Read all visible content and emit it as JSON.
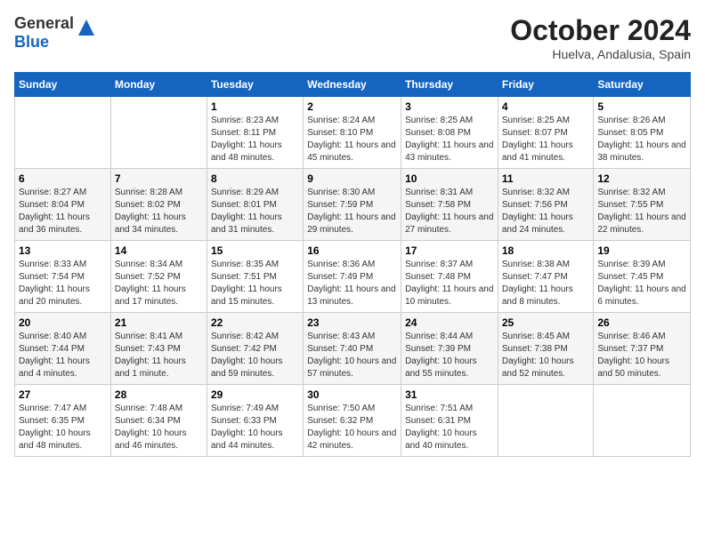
{
  "header": {
    "logo_line1": "General",
    "logo_line2": "Blue",
    "month": "October 2024",
    "location": "Huelva, Andalusia, Spain"
  },
  "weekdays": [
    "Sunday",
    "Monday",
    "Tuesday",
    "Wednesday",
    "Thursday",
    "Friday",
    "Saturday"
  ],
  "weeks": [
    [
      null,
      null,
      {
        "day": 1,
        "sunrise": "8:23 AM",
        "sunset": "8:11 PM",
        "daylight": "11 hours and 48 minutes."
      },
      {
        "day": 2,
        "sunrise": "8:24 AM",
        "sunset": "8:10 PM",
        "daylight": "11 hours and 45 minutes."
      },
      {
        "day": 3,
        "sunrise": "8:25 AM",
        "sunset": "8:08 PM",
        "daylight": "11 hours and 43 minutes."
      },
      {
        "day": 4,
        "sunrise": "8:25 AM",
        "sunset": "8:07 PM",
        "daylight": "11 hours and 41 minutes."
      },
      {
        "day": 5,
        "sunrise": "8:26 AM",
        "sunset": "8:05 PM",
        "daylight": "11 hours and 38 minutes."
      }
    ],
    [
      {
        "day": 6,
        "sunrise": "8:27 AM",
        "sunset": "8:04 PM",
        "daylight": "11 hours and 36 minutes."
      },
      {
        "day": 7,
        "sunrise": "8:28 AM",
        "sunset": "8:02 PM",
        "daylight": "11 hours and 34 minutes."
      },
      {
        "day": 8,
        "sunrise": "8:29 AM",
        "sunset": "8:01 PM",
        "daylight": "11 hours and 31 minutes."
      },
      {
        "day": 9,
        "sunrise": "8:30 AM",
        "sunset": "7:59 PM",
        "daylight": "11 hours and 29 minutes."
      },
      {
        "day": 10,
        "sunrise": "8:31 AM",
        "sunset": "7:58 PM",
        "daylight": "11 hours and 27 minutes."
      },
      {
        "day": 11,
        "sunrise": "8:32 AM",
        "sunset": "7:56 PM",
        "daylight": "11 hours and 24 minutes."
      },
      {
        "day": 12,
        "sunrise": "8:32 AM",
        "sunset": "7:55 PM",
        "daylight": "11 hours and 22 minutes."
      }
    ],
    [
      {
        "day": 13,
        "sunrise": "8:33 AM",
        "sunset": "7:54 PM",
        "daylight": "11 hours and 20 minutes."
      },
      {
        "day": 14,
        "sunrise": "8:34 AM",
        "sunset": "7:52 PM",
        "daylight": "11 hours and 17 minutes."
      },
      {
        "day": 15,
        "sunrise": "8:35 AM",
        "sunset": "7:51 PM",
        "daylight": "11 hours and 15 minutes."
      },
      {
        "day": 16,
        "sunrise": "8:36 AM",
        "sunset": "7:49 PM",
        "daylight": "11 hours and 13 minutes."
      },
      {
        "day": 17,
        "sunrise": "8:37 AM",
        "sunset": "7:48 PM",
        "daylight": "11 hours and 10 minutes."
      },
      {
        "day": 18,
        "sunrise": "8:38 AM",
        "sunset": "7:47 PM",
        "daylight": "11 hours and 8 minutes."
      },
      {
        "day": 19,
        "sunrise": "8:39 AM",
        "sunset": "7:45 PM",
        "daylight": "11 hours and 6 minutes."
      }
    ],
    [
      {
        "day": 20,
        "sunrise": "8:40 AM",
        "sunset": "7:44 PM",
        "daylight": "11 hours and 4 minutes."
      },
      {
        "day": 21,
        "sunrise": "8:41 AM",
        "sunset": "7:43 PM",
        "daylight": "11 hours and 1 minute."
      },
      {
        "day": 22,
        "sunrise": "8:42 AM",
        "sunset": "7:42 PM",
        "daylight": "10 hours and 59 minutes."
      },
      {
        "day": 23,
        "sunrise": "8:43 AM",
        "sunset": "7:40 PM",
        "daylight": "10 hours and 57 minutes."
      },
      {
        "day": 24,
        "sunrise": "8:44 AM",
        "sunset": "7:39 PM",
        "daylight": "10 hours and 55 minutes."
      },
      {
        "day": 25,
        "sunrise": "8:45 AM",
        "sunset": "7:38 PM",
        "daylight": "10 hours and 52 minutes."
      },
      {
        "day": 26,
        "sunrise": "8:46 AM",
        "sunset": "7:37 PM",
        "daylight": "10 hours and 50 minutes."
      }
    ],
    [
      {
        "day": 27,
        "sunrise": "7:47 AM",
        "sunset": "6:35 PM",
        "daylight": "10 hours and 48 minutes."
      },
      {
        "day": 28,
        "sunrise": "7:48 AM",
        "sunset": "6:34 PM",
        "daylight": "10 hours and 46 minutes."
      },
      {
        "day": 29,
        "sunrise": "7:49 AM",
        "sunset": "6:33 PM",
        "daylight": "10 hours and 44 minutes."
      },
      {
        "day": 30,
        "sunrise": "7:50 AM",
        "sunset": "6:32 PM",
        "daylight": "10 hours and 42 minutes."
      },
      {
        "day": 31,
        "sunrise": "7:51 AM",
        "sunset": "6:31 PM",
        "daylight": "10 hours and 40 minutes."
      },
      null,
      null
    ]
  ]
}
